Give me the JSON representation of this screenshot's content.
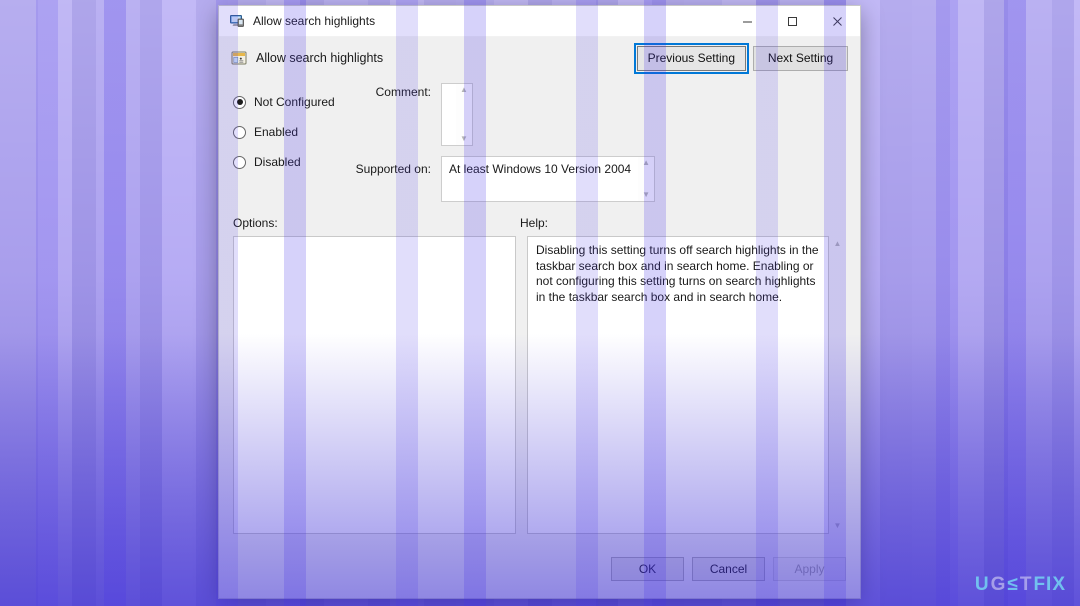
{
  "window": {
    "title": "Allow search highlights",
    "title_icon": "monitor-icon",
    "controls": {
      "minimize": "─",
      "maximize": "□",
      "close": "✕"
    }
  },
  "header": {
    "icon": "policy-setting-icon",
    "title": "Allow search highlights",
    "previous_button": "Previous Setting",
    "next_button": "Next Setting"
  },
  "state_options": [
    {
      "label": "Not Configured",
      "selected": true
    },
    {
      "label": "Enabled",
      "selected": false
    },
    {
      "label": "Disabled",
      "selected": false
    }
  ],
  "comment": {
    "label": "Comment:",
    "value": ""
  },
  "supported_on": {
    "label": "Supported on:",
    "value": "At least Windows 10 Version 2004"
  },
  "options": {
    "label": "Options:",
    "value": ""
  },
  "help": {
    "label": "Help:",
    "text": "Disabling this setting turns off search highlights in the taskbar search box and in search home. Enabling or not configuring this setting turns on search highlights in the taskbar search box and in search home."
  },
  "footer": {
    "ok": "OK",
    "cancel": "Cancel",
    "apply": "Apply",
    "apply_disabled": true
  },
  "scroll_arrows": {
    "up": "▲",
    "down": "▼"
  },
  "watermark": {
    "part1": "U",
    "part2": "G",
    "part3": "≤",
    "part4": "T",
    "part5": "FIX"
  },
  "colors": {
    "desktop_light": "#a79cec",
    "desktop_dark": "#4b3ad6",
    "dialog_bg": "#f0f0f0",
    "accent_focus": "#0078d7"
  }
}
